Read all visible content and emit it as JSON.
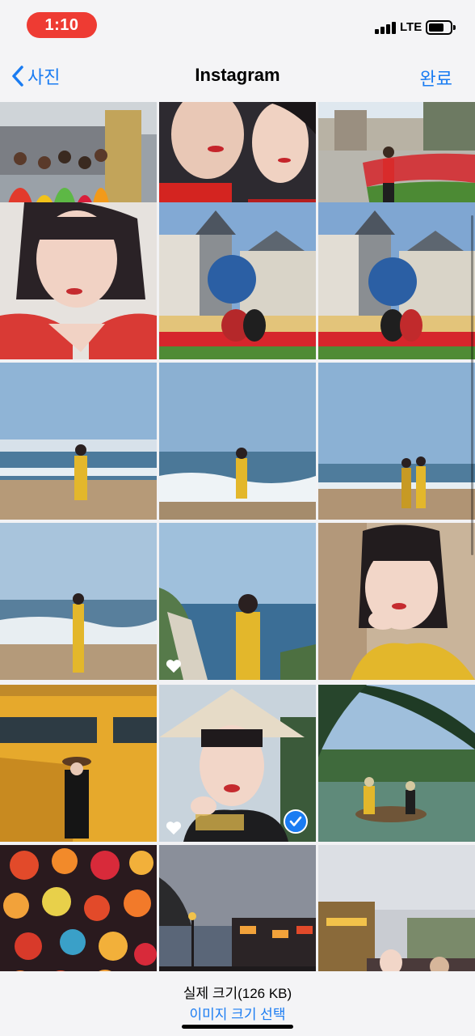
{
  "status_bar": {
    "time": "1:10",
    "network": "LTE",
    "time_pill_color": "#ee3b33"
  },
  "nav": {
    "back_label": "사진",
    "title": "Instagram",
    "done_label": "완료",
    "accent_color": "#1a7cf2"
  },
  "photos": [
    {
      "name": "photo-dancers-colorful-costumes"
    },
    {
      "name": "photo-selfie-two-girls-red"
    },
    {
      "name": "photo-girl-flower-garden-arms-up"
    },
    {
      "name": "photo-selfie-red-top"
    },
    {
      "name": "photo-two-girls-castle-globe"
    },
    {
      "name": "photo-two-girls-castle-globe-2"
    },
    {
      "name": "photo-girl-beach-yellow-dress"
    },
    {
      "name": "photo-girl-beach-waves"
    },
    {
      "name": "photo-two-girls-beach"
    },
    {
      "name": "photo-girl-beach-walking"
    },
    {
      "name": "photo-girl-sea-cliff",
      "favorite": true
    },
    {
      "name": "photo-girl-hand-on-chin"
    },
    {
      "name": "photo-girl-yellow-wall"
    },
    {
      "name": "photo-girl-conical-hat",
      "favorite": true,
      "selected": true
    },
    {
      "name": "photo-basket-boat-palm"
    },
    {
      "name": "photo-lanterns-night"
    },
    {
      "name": "photo-old-town-dusk"
    },
    {
      "name": "photo-girl-street-dusk"
    }
  ],
  "toolbar": {
    "size_label": "실제 크기(126 KB)",
    "size_select_label": "이미지 크기 선택"
  }
}
